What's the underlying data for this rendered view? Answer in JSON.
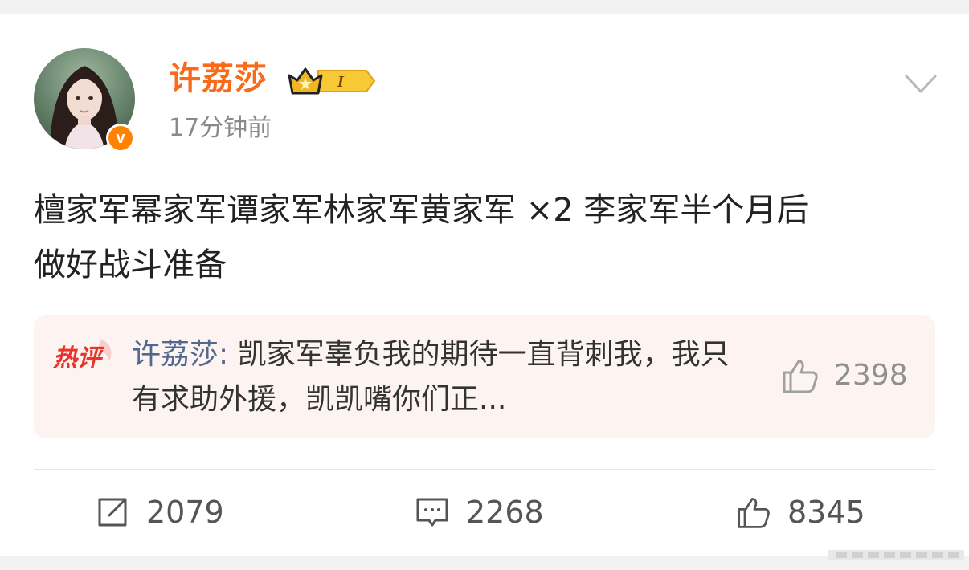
{
  "post": {
    "user": {
      "name": "许荔莎",
      "verified_badge": "v",
      "vip_level": "I"
    },
    "timestamp": "17分钟前",
    "text_line1": "檀家军幂家军谭家军林家军黄家军 ×2 李家军半个月后",
    "text_line2": "做好战斗准备"
  },
  "hot_comment": {
    "label": "热评",
    "author": "许荔莎:",
    "text": " 凯家军辜负我的期待一直背刺我，我只有求助外援，凯凯嘴你们正...",
    "likes": "2398"
  },
  "actions": {
    "repost_count": "2079",
    "comment_count": "2268",
    "like_count": "8345"
  },
  "icons": {
    "more": "chevron-down-icon",
    "repost": "repost-icon",
    "comment": "comment-icon",
    "like": "thumbs-up-icon",
    "vip": "crown-badge-icon"
  },
  "colors": {
    "username": "#f86b1a",
    "verified": "#ff8200",
    "hot_bg": "#fdf4f2",
    "hot_author": "#52698f",
    "hot_label": "#e8342a"
  }
}
